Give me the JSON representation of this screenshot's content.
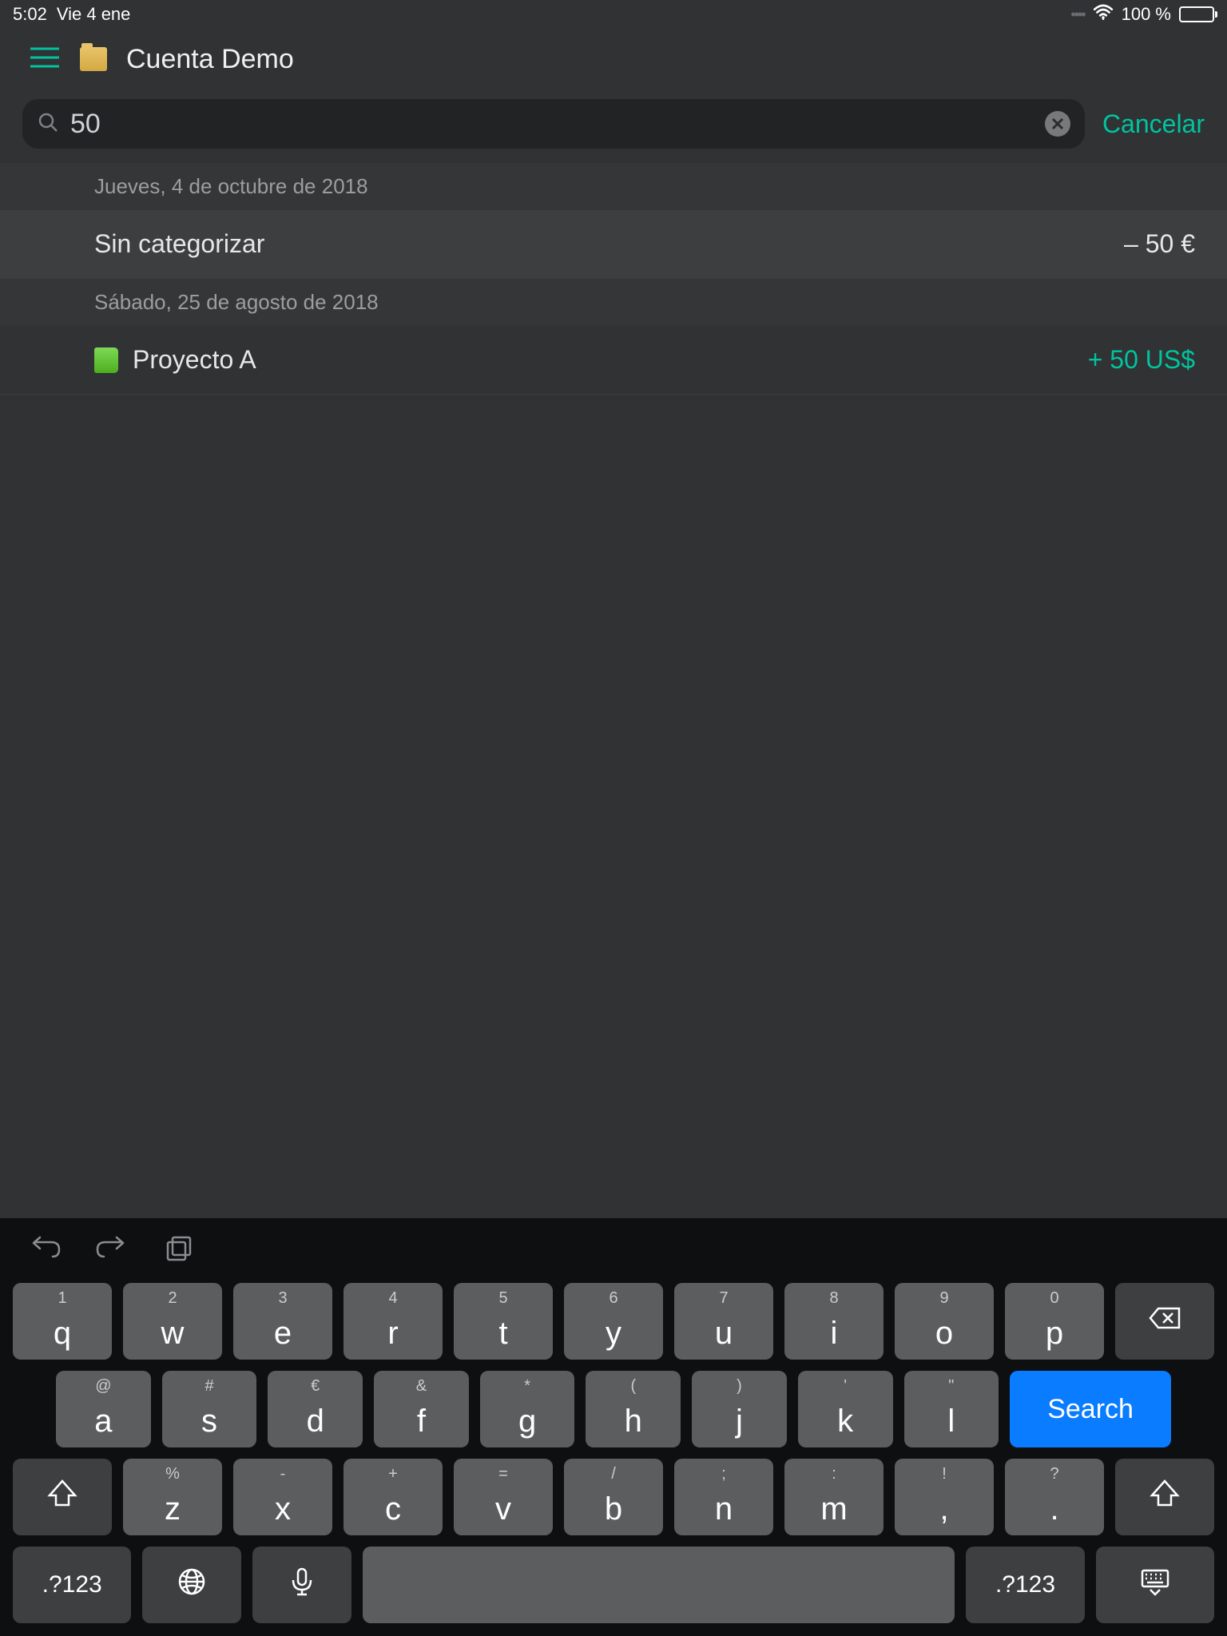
{
  "status": {
    "time": "5:02",
    "date": "Vie 4 ene",
    "battery_pct": "100 %"
  },
  "header": {
    "title": "Cuenta Demo"
  },
  "search": {
    "value": "50",
    "cancel_label": "Cancelar"
  },
  "sections": [
    {
      "date": "Jueves, 4 de octubre de 2018",
      "rows": [
        {
          "label": "Sin categorizar",
          "amount": "– 50 €",
          "type": "neg",
          "icon": null,
          "highlight": true
        }
      ]
    },
    {
      "date": "Sábado, 25 de agosto de 2018",
      "rows": [
        {
          "label": "Proyecto A",
          "amount": "+ 50 US$",
          "type": "pos",
          "icon": "green-book",
          "highlight": false
        }
      ]
    }
  ],
  "keyboard": {
    "row1": [
      {
        "main": "q",
        "alt": "1"
      },
      {
        "main": "w",
        "alt": "2"
      },
      {
        "main": "e",
        "alt": "3"
      },
      {
        "main": "r",
        "alt": "4"
      },
      {
        "main": "t",
        "alt": "5"
      },
      {
        "main": "y",
        "alt": "6"
      },
      {
        "main": "u",
        "alt": "7"
      },
      {
        "main": "i",
        "alt": "8"
      },
      {
        "main": "o",
        "alt": "9"
      },
      {
        "main": "p",
        "alt": "0"
      }
    ],
    "row2": [
      {
        "main": "a",
        "alt": "@"
      },
      {
        "main": "s",
        "alt": "#"
      },
      {
        "main": "d",
        "alt": "€"
      },
      {
        "main": "f",
        "alt": "&"
      },
      {
        "main": "g",
        "alt": "*"
      },
      {
        "main": "h",
        "alt": "("
      },
      {
        "main": "j",
        "alt": ")"
      },
      {
        "main": "k",
        "alt": "'"
      },
      {
        "main": "l",
        "alt": "\""
      }
    ],
    "row3": [
      {
        "main": "z",
        "alt": "%"
      },
      {
        "main": "x",
        "alt": "-"
      },
      {
        "main": "c",
        "alt": "+"
      },
      {
        "main": "v",
        "alt": "="
      },
      {
        "main": "b",
        "alt": "/"
      },
      {
        "main": "n",
        "alt": ";"
      },
      {
        "main": "m",
        "alt": ":"
      },
      {
        "main": ",",
        "alt": "!"
      },
      {
        "main": ".",
        "alt": "?"
      }
    ],
    "search_label": "Search",
    "numsym_label": ".?123"
  }
}
